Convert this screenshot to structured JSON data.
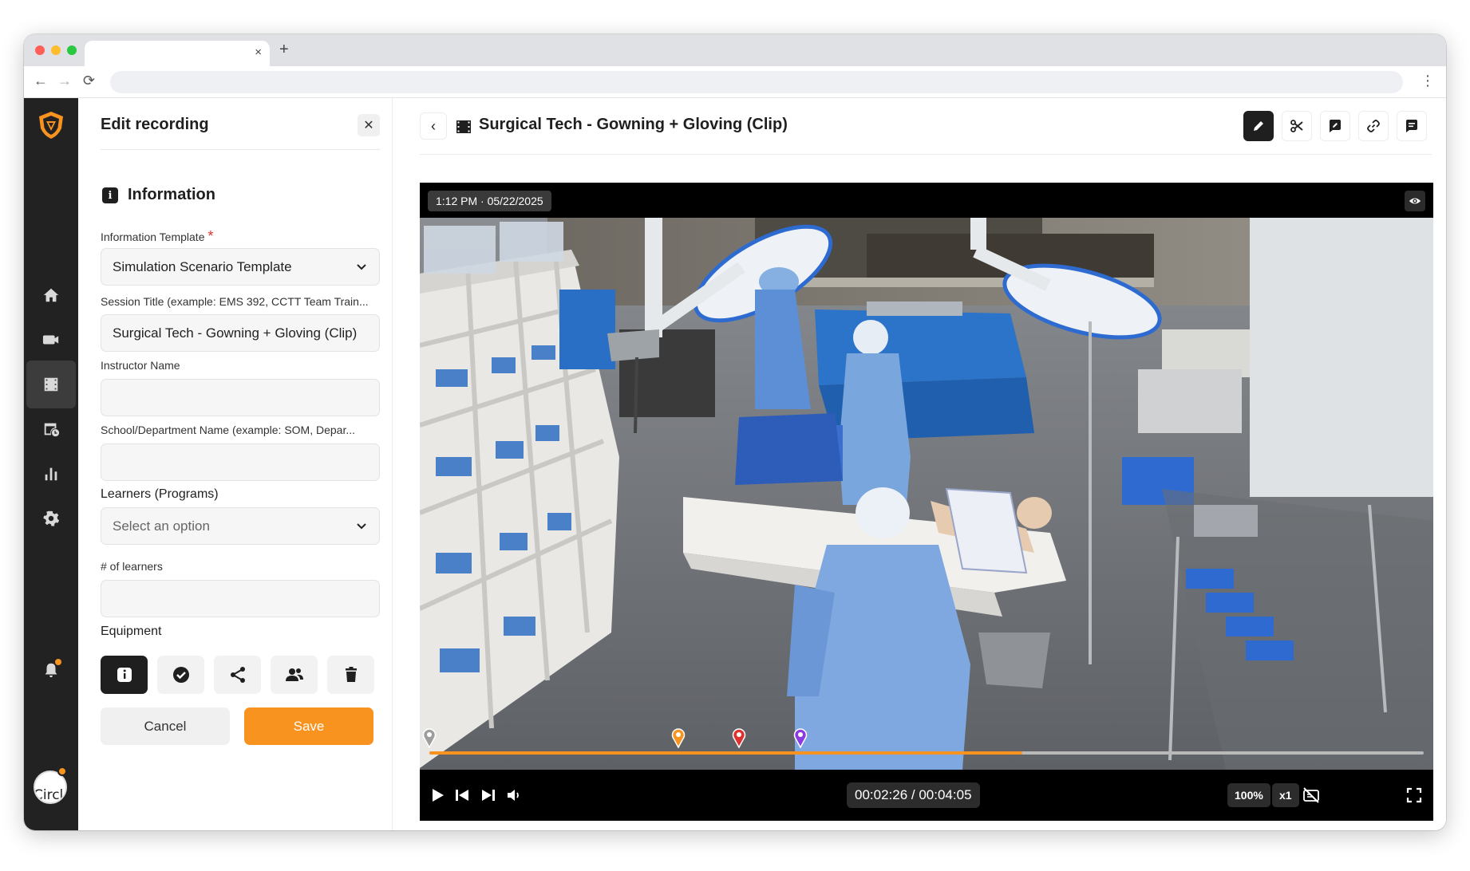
{
  "browser": {
    "tab_close": "×",
    "new_tab": "+",
    "back": "←",
    "forward": "→",
    "reload": "⟳",
    "menu": "⋮"
  },
  "edit_panel": {
    "title": "Edit recording",
    "close": "✕",
    "section_title": "Information",
    "fields": {
      "template": {
        "label": "Information Template",
        "required_mark": "*",
        "value": "Simulation Scenario Template"
      },
      "session_title": {
        "label": "Session Title (example: EMS 392, CCTT Team Train...",
        "value": "Surgical Tech - Gowning + Gloving (Clip)"
      },
      "instructor": {
        "label": "Instructor Name",
        "value": ""
      },
      "school": {
        "label": "School/Department Name (example: SOM, Depar...",
        "value": ""
      },
      "learners": {
        "label": "Learners (Programs)",
        "placeholder": "Select an option"
      },
      "num_learners": {
        "label": "# of learners",
        "value": ""
      },
      "equipment": {
        "label": "Equipment"
      }
    },
    "cancel_label": "Cancel",
    "save_label": "Save"
  },
  "main": {
    "back": "‹",
    "title": "Surgical Tech - Gowning + Gloving (Clip)"
  },
  "player": {
    "timestamp": "1:12 PM · 05/22/2025",
    "time_display": "00:02:26 / 00:04:05",
    "zoom": "100%",
    "speed": "x1",
    "progress": 0.596,
    "markers": [
      {
        "time_fraction": 0.0,
        "color": "#9e9e9e"
      },
      {
        "time_fraction": 0.25,
        "color": "#f7931e"
      },
      {
        "time_fraction": 0.311,
        "color": "#e03131"
      },
      {
        "time_fraction": 0.373,
        "color": "#8c3be0"
      }
    ]
  },
  "user": {
    "avatar_text": "Circle"
  },
  "colors": {
    "accent": "#f7931e",
    "rail": "#222222",
    "dark": "#1f1f1f"
  }
}
